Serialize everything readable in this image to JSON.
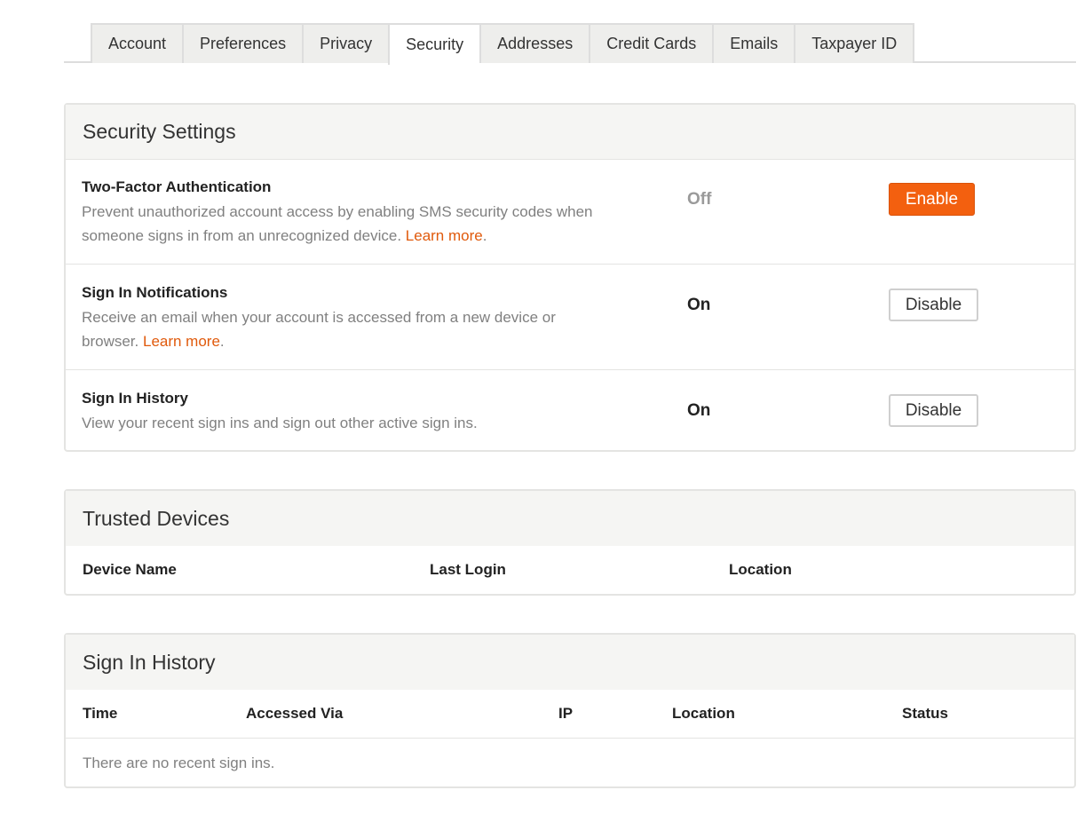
{
  "tabs": [
    "Account",
    "Preferences",
    "Privacy",
    "Security",
    "Addresses",
    "Credit Cards",
    "Emails",
    "Taxpayer ID"
  ],
  "active_tab": "Security",
  "security_settings": {
    "title": "Security Settings",
    "rows": [
      {
        "title": "Two-Factor Authentication",
        "desc_line1": "Prevent unauthorized account access by enabling SMS security codes when",
        "desc_line2": "someone signs in from an unrecognized device.",
        "learn_more": "Learn more",
        "status": "Off",
        "button": "Enable"
      },
      {
        "title": "Sign In Notifications",
        "desc_line1": "Receive an email when your account is accessed from a new device or",
        "desc_line2": "browser.",
        "learn_more": "Learn more",
        "status": "On",
        "button": "Disable"
      },
      {
        "title": "Sign In History",
        "desc_line1": "View your recent sign ins and sign out other active sign ins.",
        "status": "On",
        "button": "Disable"
      }
    ]
  },
  "trusted_devices": {
    "title": "Trusted Devices",
    "columns": [
      "Device Name",
      "Last Login",
      "Location"
    ]
  },
  "sign_in_history": {
    "title": "Sign In History",
    "columns": [
      "Time",
      "Accessed Via",
      "IP",
      "Location",
      "Status"
    ],
    "empty_message": "There are no recent sign ins."
  }
}
